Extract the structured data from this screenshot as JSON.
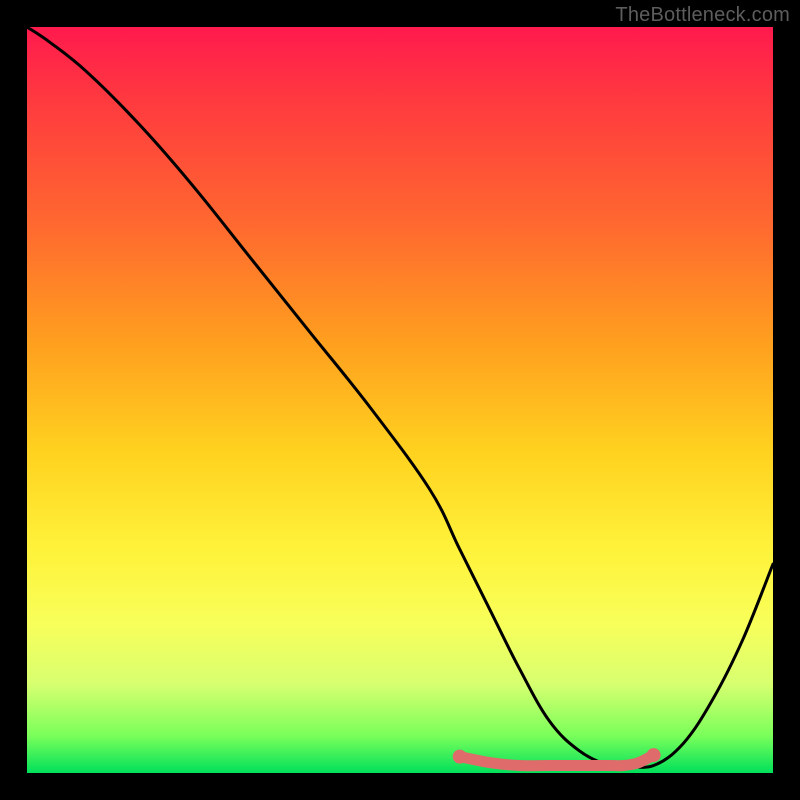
{
  "watermark": "TheBottleneck.com",
  "chart_data": {
    "type": "line",
    "title": "",
    "xlabel": "",
    "ylabel": "",
    "xlim": [
      0,
      100
    ],
    "ylim": [
      0,
      100
    ],
    "series": [
      {
        "name": "curve",
        "color": "#000000",
        "x": [
          0,
          3,
          8,
          15,
          22,
          30,
          38,
          46,
          54,
          58,
          62,
          66,
          70,
          74,
          78,
          80,
          84,
          88,
          92,
          96,
          100
        ],
        "y": [
          100,
          98,
          94,
          87,
          79,
          69,
          59,
          49,
          38,
          30,
          22,
          14,
          7,
          3,
          1,
          1,
          1,
          4,
          10,
          18,
          28
        ]
      },
      {
        "name": "marker-band",
        "color": "#e06060",
        "x": [
          58,
          62,
          66,
          70,
          74,
          78,
          80,
          82,
          84
        ],
        "y": [
          2.2,
          1.4,
          1.0,
          1.0,
          1.0,
          1.0,
          1.0,
          1.4,
          2.4
        ]
      }
    ],
    "gradient_stops": [
      {
        "pos": 0,
        "color": "#ff1a4d"
      },
      {
        "pos": 10,
        "color": "#ff3a3f"
      },
      {
        "pos": 27,
        "color": "#ff6a2f"
      },
      {
        "pos": 42,
        "color": "#ff9e1f"
      },
      {
        "pos": 57,
        "color": "#ffd21f"
      },
      {
        "pos": 70,
        "color": "#fff23a"
      },
      {
        "pos": 80,
        "color": "#f8ff5a"
      },
      {
        "pos": 88,
        "color": "#d8ff70"
      },
      {
        "pos": 95,
        "color": "#7aff5a"
      },
      {
        "pos": 100,
        "color": "#00e05a"
      }
    ],
    "marker_endpoints": [
      {
        "x": 58,
        "y": 2.2
      },
      {
        "x": 84,
        "y": 2.4
      }
    ]
  }
}
